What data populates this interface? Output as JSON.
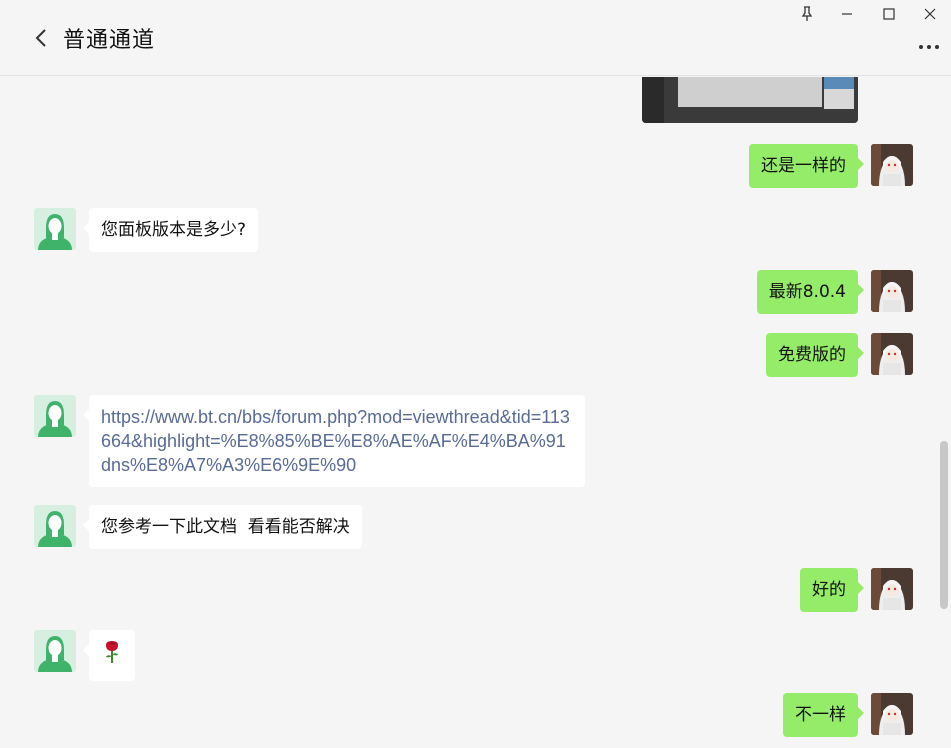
{
  "header": {
    "title": "普通通道",
    "back_icon": "chevron-left-icon",
    "window_controls": [
      "pin-icon",
      "minimize-icon",
      "maximize-icon",
      "close-icon"
    ],
    "more_icon": "more-dots-icon"
  },
  "colors": {
    "background": "#f5f5f5",
    "self_bubble": "#95ec69",
    "other_bubble": "#ffffff",
    "link": "#576b95",
    "other_avatar": "#3fb36a"
  },
  "messages": [
    {
      "side": "right",
      "type": "image",
      "text": ""
    },
    {
      "side": "right",
      "type": "text",
      "text": "还是一样的"
    },
    {
      "side": "left",
      "type": "text",
      "text": "您面板版本是多少?"
    },
    {
      "side": "right",
      "type": "text",
      "text": "最新8.0.4"
    },
    {
      "side": "right",
      "type": "text",
      "text": "免费版的"
    },
    {
      "side": "left",
      "type": "link",
      "text": "https://www.bt.cn/bbs/forum.php?mod=viewthread&tid=113664&highlight=%E8%85%BE%E8%AE%AF%E4%BA%91dns%E8%A7%A3%E6%9E%90"
    },
    {
      "side": "left",
      "type": "text",
      "text": "您参考一下此文档  看看能否解决"
    },
    {
      "side": "right",
      "type": "text",
      "text": "好的"
    },
    {
      "side": "left",
      "type": "emoji",
      "text": "🌹"
    },
    {
      "side": "right",
      "type": "text",
      "text": "不一样"
    }
  ]
}
